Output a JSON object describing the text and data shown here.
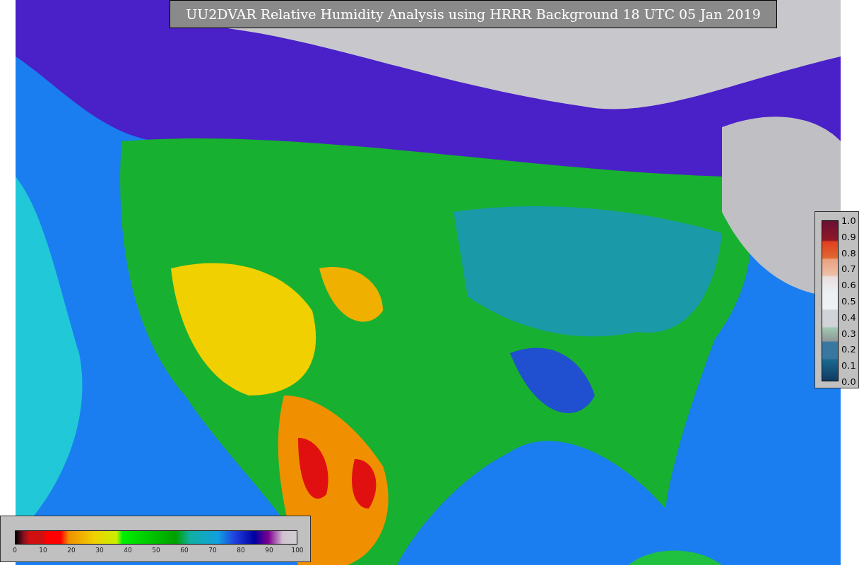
{
  "title": "UU2DVAR Relative Humidity Analysis using HRRR Background 18 UTC 05 Jan 2019",
  "humidity_colorbar": {
    "ticks": [
      "0",
      "10",
      "20",
      "30",
      "40",
      "50",
      "60",
      "70",
      "80",
      "90",
      "100"
    ]
  },
  "side_colorbar": {
    "ticks": [
      "1.0",
      "0.9",
      "0.8",
      "0.7",
      "0.6",
      "0.5",
      "0.4",
      "0.3",
      "0.2",
      "0.1",
      "0.0"
    ]
  }
}
